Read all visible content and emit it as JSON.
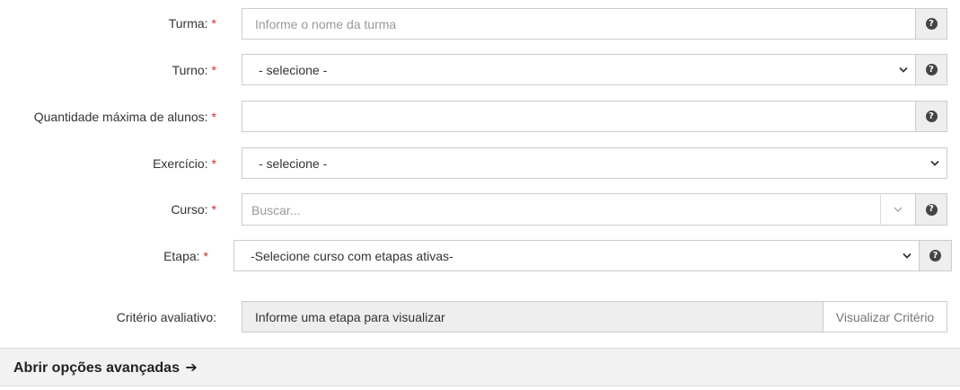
{
  "form": {
    "turma": {
      "label": "Turma:",
      "required": "*",
      "placeholder": "Informe o nome da turma"
    },
    "turno": {
      "label": "Turno:",
      "required": "*",
      "selected": "- selecione -"
    },
    "quantidade": {
      "label": "Quantidade máxima de alunos:",
      "required": "*",
      "value": ""
    },
    "exercicio": {
      "label": "Exercício:",
      "required": "*",
      "selected": "- selecione -"
    },
    "curso": {
      "label": "Curso:",
      "required": "*",
      "placeholder": "Buscar..."
    },
    "etapa": {
      "label": "Etapa:",
      "required": "*",
      "selected": "-Selecione curso com etapas ativas-"
    },
    "criterio": {
      "label": "Critério avaliativo:",
      "value": "Informe uma etapa para visualizar",
      "button": "Visualizar Critério"
    }
  },
  "advanced": {
    "label": "Abrir opções avançadas",
    "arrow": "➔"
  },
  "icons": {
    "help": "?",
    "accent_red": "#c9302c"
  }
}
